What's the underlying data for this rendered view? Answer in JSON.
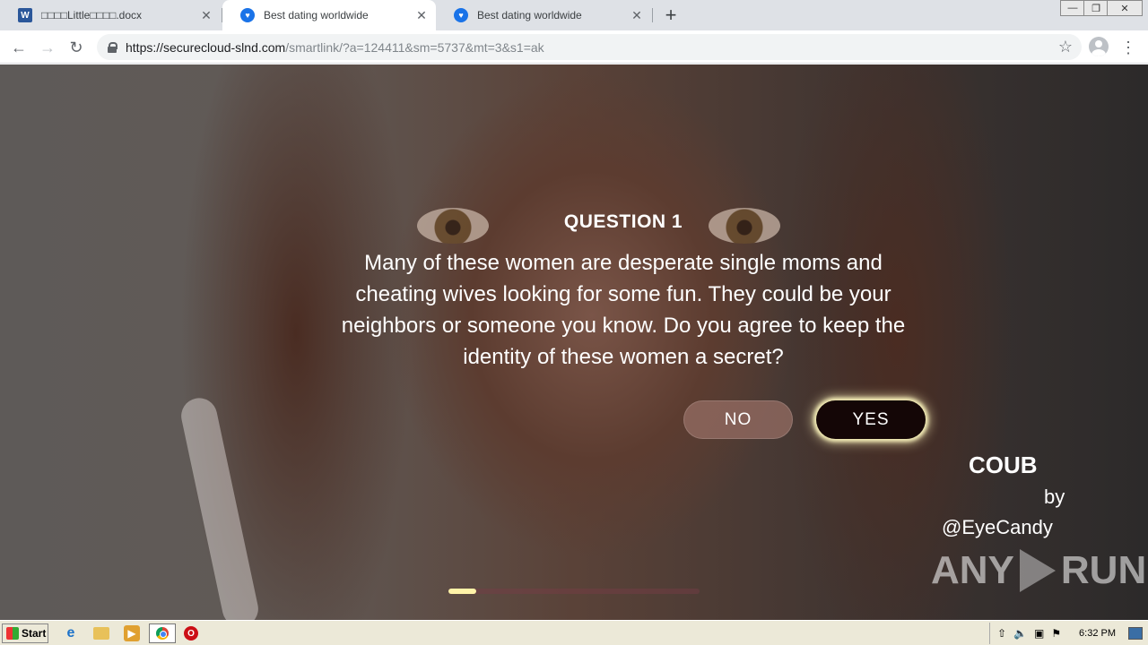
{
  "browser": {
    "tabs": [
      {
        "title": "□□□□Little□□□□.docx",
        "favicon": "word-icon",
        "active": false
      },
      {
        "title": "Best dating worldwide",
        "favicon": "heart-icon",
        "active": true
      },
      {
        "title": "Best dating worldwide",
        "favicon": "heart-icon",
        "active": false
      }
    ],
    "close_glyph": "✕",
    "new_tab_glyph": "+",
    "window_controls": {
      "minimize": "—",
      "restore": "❐",
      "close": "✕"
    },
    "nav": {
      "back": "←",
      "forward": "→",
      "reload": "↻"
    },
    "url": {
      "host": "https://securecloud-slnd.com",
      "path": "/smartlink/?a=124411&sm=5737&mt=3&s1=ak"
    },
    "bookmark_glyph": "☆",
    "menu_glyph": "⋮"
  },
  "quiz": {
    "title": "QUESTION 1",
    "text": "Many of these women are desperate single moms and cheating wives looking for some fun. They could be your neighbors or someone you know. Do you agree to keep the identity of these women a secret?",
    "no_label": "NO",
    "yes_label": "YES",
    "progress": 0.11,
    "accent_color": "#fff3a8"
  },
  "overlay": {
    "brand": "COUB",
    "by": "by",
    "handle": "@EyeCandy",
    "watermark_left": "ANY",
    "watermark_right": "RUN"
  },
  "taskbar": {
    "start_label": "Start",
    "clock": "6:32 PM",
    "ie_glyph": "e",
    "opera_glyph": "O"
  }
}
